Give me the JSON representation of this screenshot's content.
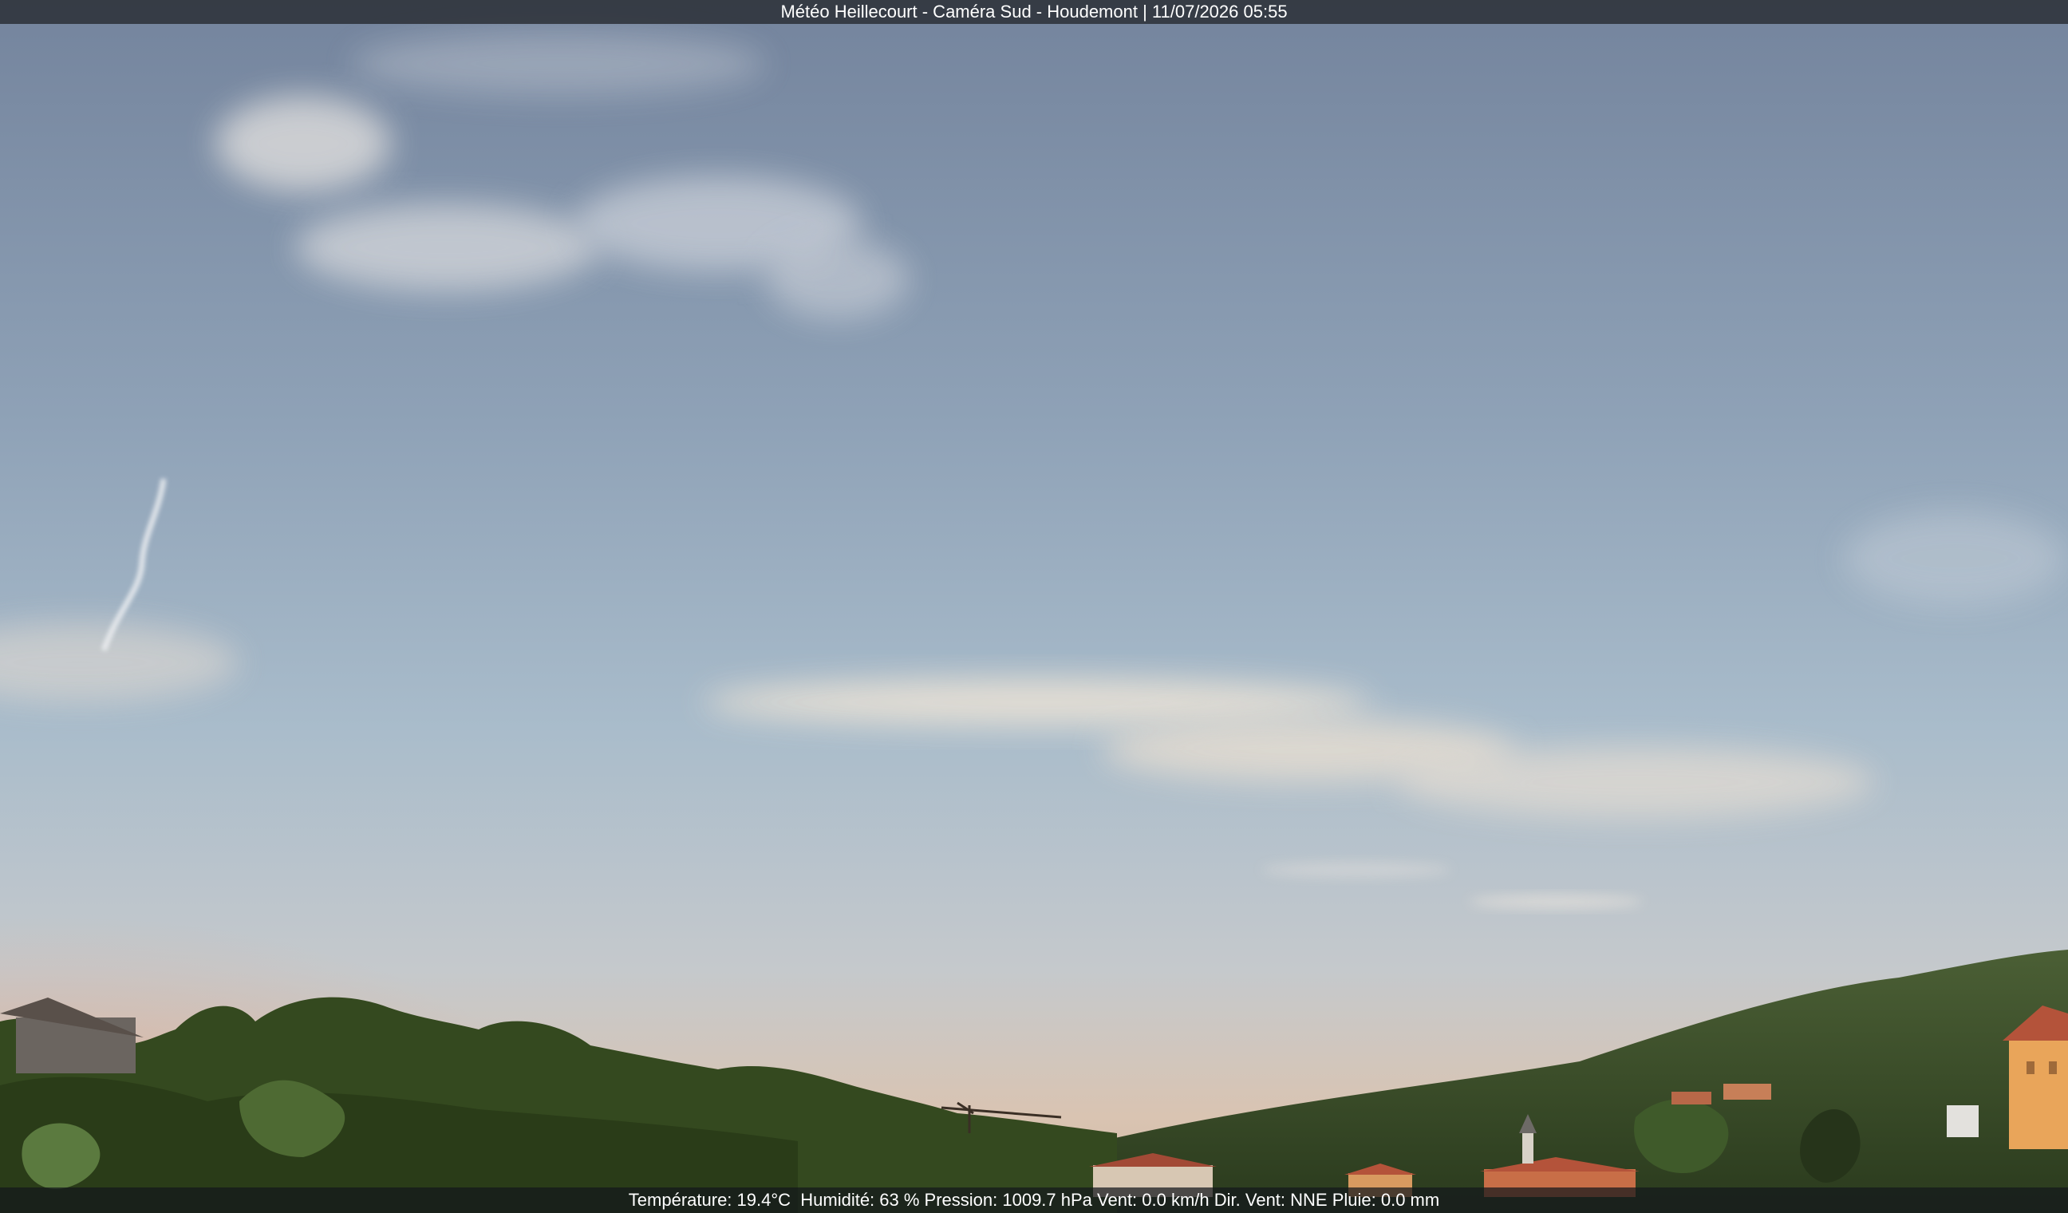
{
  "webcam": {
    "title": "Météo Heillecourt - Caméra Sud - Houdemont | 11/07/2026 05:55",
    "weather_readout": "Température: 19.4°C  Humidité: 63 % Pression: 1009.7 hPa Vent: 0.0 km/h Dir. Vent: NNE Pluie: 0.0 mm"
  },
  "colors": {
    "sky_top": "#7f90a8",
    "sky_mid": "#a3b6c6",
    "sky_horizon": "#d8c6b4",
    "sky_glow": "#e7a98c",
    "tree_dark": "#243a1c",
    "tree_mid": "#3d5a2a",
    "roof": "#b4533a",
    "facade": "#e9a55a"
  }
}
